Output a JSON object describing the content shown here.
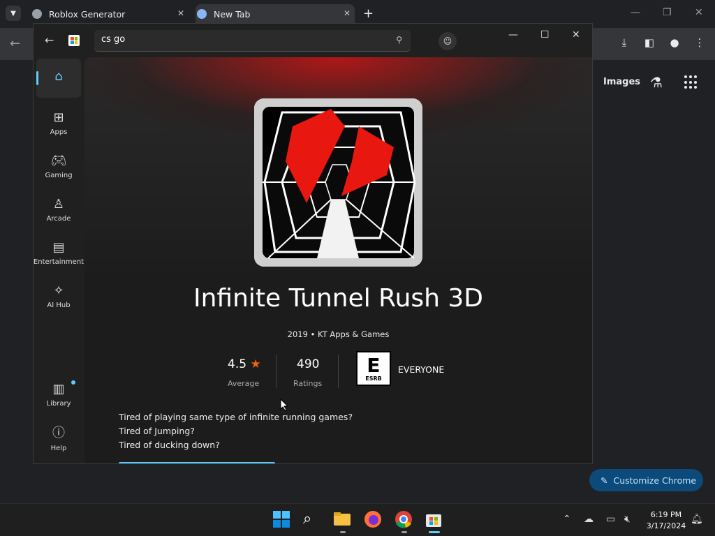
{
  "chrome": {
    "tabs": [
      {
        "title": "Roblox Generator",
        "active": false
      },
      {
        "title": "New Tab",
        "active": true
      }
    ],
    "new_tab_glyph": "+",
    "images_link": "Images",
    "customize_label": "Customize Chrome"
  },
  "store": {
    "search_value": "cs go",
    "nav": [
      {
        "label": "",
        "icon": "home-icon"
      },
      {
        "label": "Apps",
        "icon": "apps-icon"
      },
      {
        "label": "Gaming",
        "icon": "gaming-icon"
      },
      {
        "label": "Arcade",
        "icon": "arcade-icon"
      },
      {
        "label": "Entertainment",
        "icon": "entertainment-icon"
      },
      {
        "label": "AI Hub",
        "icon": "ai-hub-icon"
      },
      {
        "label": "Library",
        "icon": "library-icon"
      },
      {
        "label": "Help",
        "icon": "help-icon"
      }
    ],
    "app": {
      "title": "Infinite Tunnel Rush 3D",
      "year": "2019",
      "publisher": "KT Apps & Games",
      "rating": "4.5",
      "rating_label": "Average",
      "ratings_count": "490",
      "ratings_label": "Ratings",
      "esrb_letter": "E",
      "esrb_brand": "ESRB",
      "age_rating": "EVERYONE",
      "description": [
        "Tired of playing same type of infinite running games?",
        "Tired of Jumping?",
        "Tired of ducking down?"
      ]
    }
  },
  "taskbar": {
    "time": "6:19 PM",
    "date": "3/17/2024"
  },
  "colors": {
    "accent": "#60cdff",
    "star": "#f7630c",
    "customize_bg": "#0b4a7a"
  }
}
